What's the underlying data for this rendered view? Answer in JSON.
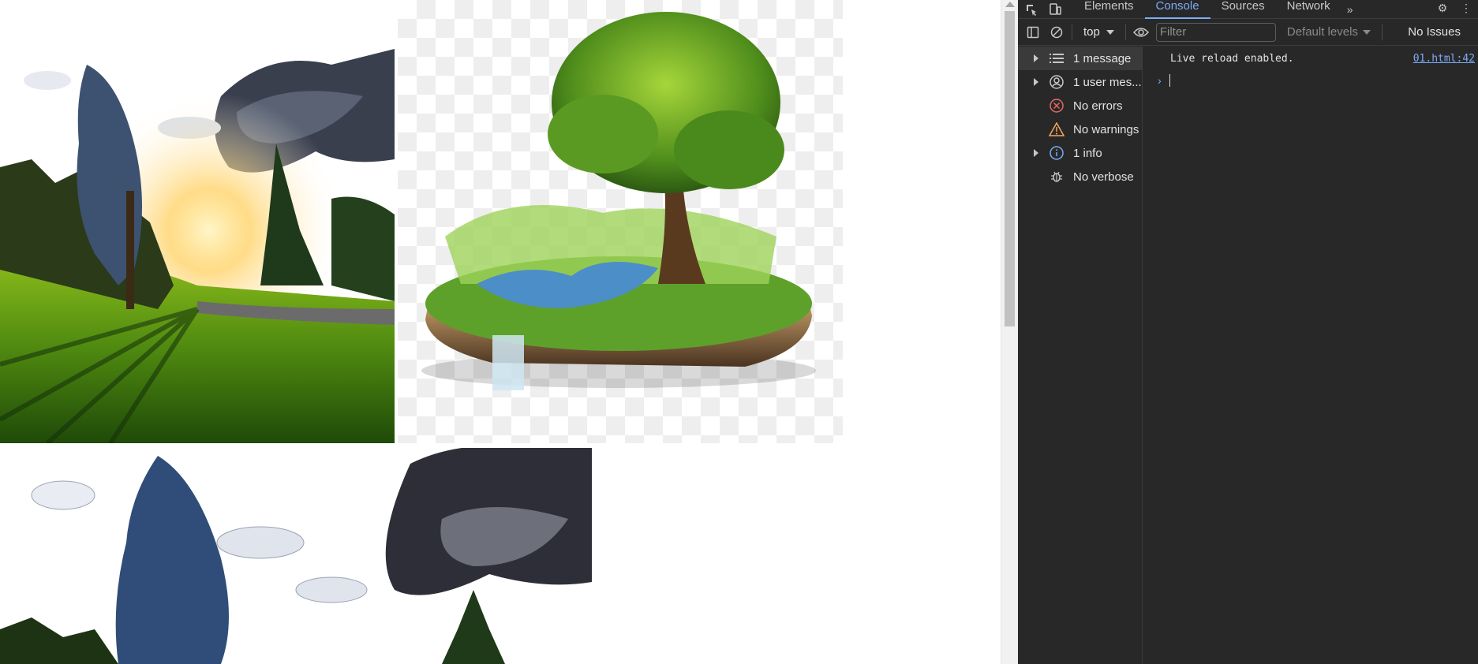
{
  "page": {
    "images": [
      {
        "name": "park-sunset-photo"
      },
      {
        "name": "floating-island-tree-image"
      },
      {
        "name": "park-sunset-photo-filtered"
      }
    ]
  },
  "devtools": {
    "tabs": [
      {
        "label": "Elements"
      },
      {
        "label": "Console"
      },
      {
        "label": "Sources"
      },
      {
        "label": "Network"
      }
    ],
    "active_tab": "Console",
    "toolbar": {
      "context": "top",
      "filter_placeholder": "Filter",
      "levels": "Default levels",
      "issues": "No Issues"
    },
    "sidebar": [
      {
        "label": "1 message",
        "icon": "list-icon"
      },
      {
        "label": "1 user mes...",
        "icon": "user-icon"
      },
      {
        "label": "No errors",
        "icon": "error-icon"
      },
      {
        "label": "No warnings",
        "icon": "warning-icon"
      },
      {
        "label": "1 info",
        "icon": "info-icon"
      },
      {
        "label": "No verbose",
        "icon": "bug-icon"
      }
    ],
    "console": {
      "messages": [
        {
          "text": "Live reload enabled.",
          "source": "01.html:42"
        }
      ]
    },
    "colors": {
      "accent": "#7cacf8",
      "error": "#e46962",
      "warning": "#f9a55b",
      "background": "#282828"
    }
  }
}
